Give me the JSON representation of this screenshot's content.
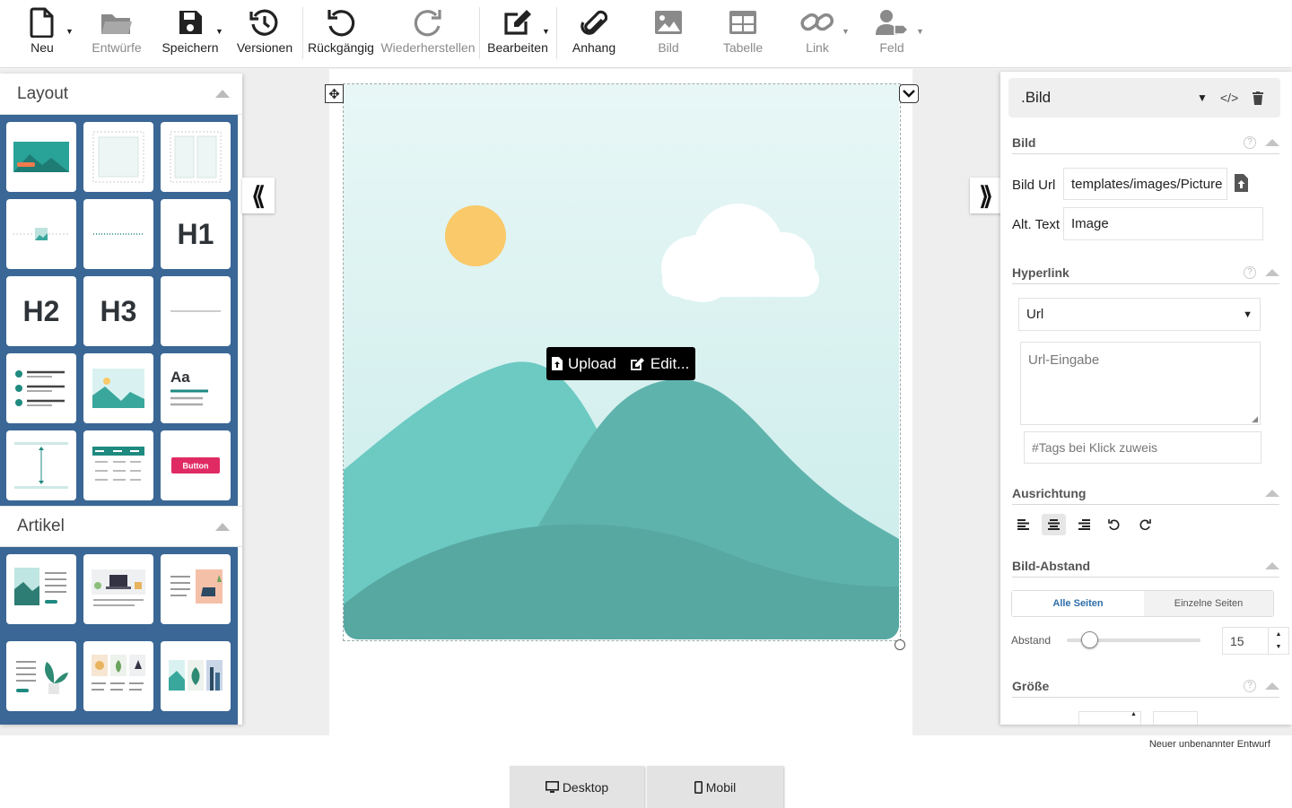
{
  "toolbar": {
    "new": "Neu",
    "drafts": "Entwürfe",
    "save": "Speichern",
    "versions": "Versionen",
    "undo": "Rückgängig",
    "redo": "Wiederherstellen",
    "edit": "Bearbeiten",
    "attachment": "Anhang",
    "image": "Bild",
    "table": "Tabelle",
    "link": "Link",
    "field": "Feld"
  },
  "left_panel": {
    "layout_title": "Layout",
    "article_title": "Artikel",
    "tiles": {
      "h1": "H1",
      "h2": "H2",
      "h3": "H3",
      "aa": "Aa",
      "button": "Button"
    }
  },
  "image_toolbar": {
    "upload": "Upload",
    "edit": "Edit..."
  },
  "right_panel": {
    "element_type": ".Bild",
    "section_image": "Bild",
    "image_url_label": "Bild Url",
    "image_url_value": "templates/images/Picture",
    "alt_label": "Alt. Text",
    "alt_value": "Image",
    "section_hyperlink": "Hyperlink",
    "link_type": "Url",
    "url_placeholder": "Url-Eingabe",
    "tags_placeholder": "#Tags bei Klick zuweis",
    "section_alignment": "Ausrichtung",
    "section_spacing": "Bild-Abstand",
    "tab_all_sides": "Alle Seiten",
    "tab_single_sides": "Einzelne Seiten",
    "spacing_label": "Abstand",
    "spacing_value": "15",
    "section_size": "Größe",
    "help": "?"
  },
  "status": {
    "draft_name": "Neuer unbenannter Entwurf"
  },
  "device": {
    "desktop": "Desktop",
    "mobile": "Mobil"
  },
  "colors": {
    "sidebar_blue": "#3a6795",
    "accent_blue": "#2f6ea8",
    "teal": "#5fb8b0",
    "sky": "#d9f2f1",
    "sun": "#f9c96a"
  },
  "icons": [
    "file-icon",
    "folder-icon",
    "save-icon",
    "history-icon",
    "undo-icon",
    "redo-icon",
    "edit-icon",
    "paperclip-icon",
    "image-icon",
    "table-icon",
    "link-icon",
    "user-field-icon",
    "code-icon",
    "trash-icon",
    "upload-file-icon"
  ]
}
